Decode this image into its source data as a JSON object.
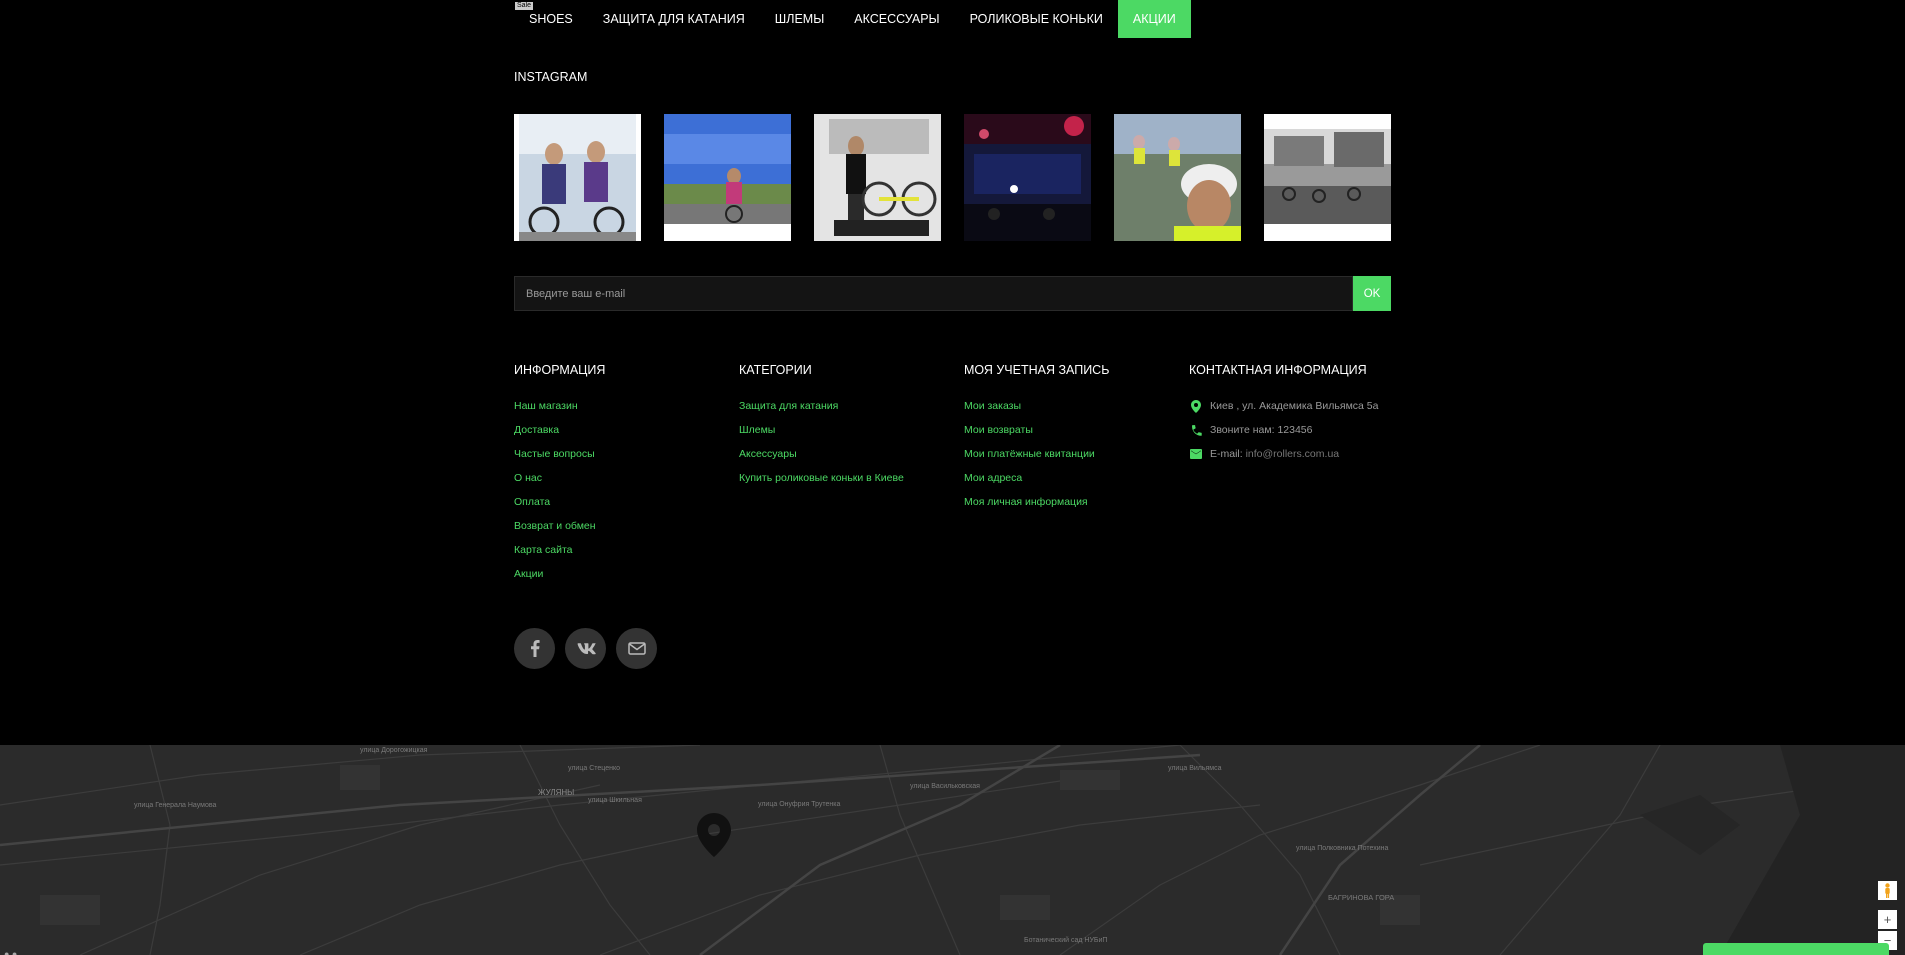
{
  "nav": {
    "badge": "Sale",
    "items": [
      {
        "label": "SHOES",
        "active": false
      },
      {
        "label": "ЗАЩИТА ДЛЯ КАТАНИЯ",
        "active": false
      },
      {
        "label": "ШЛЕМЫ",
        "active": false
      },
      {
        "label": "АКСЕССУАРЫ",
        "active": false
      },
      {
        "label": "РОЛИКОВЫЕ КОНЬКИ",
        "active": false
      },
      {
        "label": "АКЦИИ",
        "active": true
      }
    ]
  },
  "instagram": {
    "title": "INSTAGRAM"
  },
  "newsletter": {
    "placeholder": "Введите ваш e-mail",
    "button": "OK"
  },
  "footer": {
    "info": {
      "title": "ИНФОРМАЦИЯ",
      "links": [
        "Наш магазин",
        "Доставка",
        "Частые вопросы",
        "О нас",
        "Оплата",
        "Возврат и обмен",
        "Карта сайта",
        "Акции"
      ]
    },
    "categories": {
      "title": "КАТЕГОРИИ",
      "links": [
        "Защита для катания",
        "Шлемы",
        "Аксессуары",
        "Купить роликовые коньки в Киеве"
      ]
    },
    "account": {
      "title": "МОЯ УЧЕТНАЯ ЗАПИСЬ",
      "links": [
        "Мои заказы",
        "Мои возвраты",
        "Мои платёжные квитанции",
        "Мои адреса",
        "Моя личная информация"
      ]
    },
    "contact": {
      "title": "КОНТАКТНАЯ ИНФОРМАЦИЯ",
      "address": "Киев , ул. Академика Вильямса 5а",
      "phone": "Звоните нам: 123456",
      "email_label": "E-mail:",
      "email": "info@rollers.com.ua"
    }
  },
  "social": [
    "facebook-icon",
    "vk-icon",
    "email-icon"
  ],
  "map": {
    "labels": [
      "ЖУЛЯНЫ",
      "улица Шкильная",
      "улица Стеценко",
      "улица Генерала Наумова",
      "улица Онуфрия Трутенка",
      "улица Васильковская",
      "улица Вильямса",
      "БАГРИНОВА ГОРА",
      "Ботанический сад НУБиП",
      "улица Дорогожицкая",
      "улица Полковника Потехина"
    ],
    "zoom_in": "+",
    "zoom_out": "−"
  },
  "colors": {
    "accent": "#4cd964",
    "background": "#000000",
    "map": "#2b2b2b"
  }
}
